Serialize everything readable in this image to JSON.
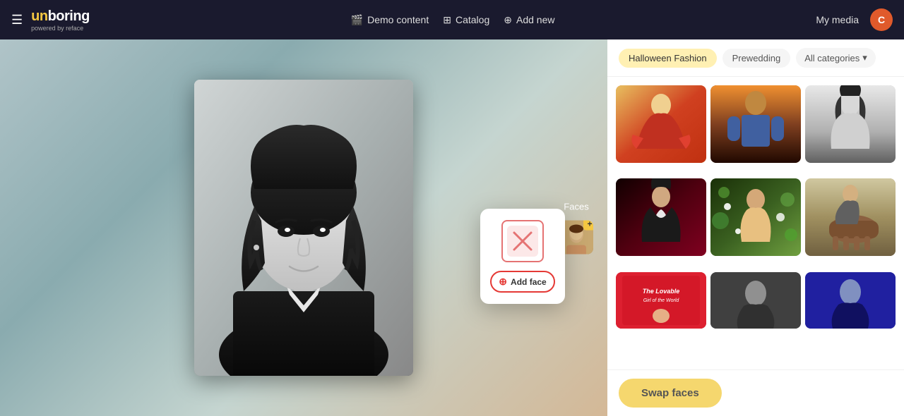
{
  "header": {
    "menu_icon": "☰",
    "logo_main": "unboring",
    "logo_highlight": "un",
    "logo_sub": "powered by reface",
    "nav": [
      {
        "id": "demo-content",
        "icon": "🎬",
        "label": "Demo content"
      },
      {
        "id": "catalog",
        "icon": "⊞",
        "label": "Catalog"
      },
      {
        "id": "add-new",
        "icon": "⊕",
        "label": "Add new"
      }
    ],
    "my_media": "My media",
    "avatar_letter": "C"
  },
  "categories": [
    {
      "id": "halloween",
      "label": "Halloween Fashion",
      "active": true
    },
    {
      "id": "prewedding",
      "label": "Prewedding",
      "active": false
    },
    {
      "id": "all",
      "label": "All categories",
      "active": false
    }
  ],
  "faces": {
    "label": "Faces"
  },
  "popup": {
    "add_face_label": "Add face"
  },
  "grid": {
    "images": [
      {
        "id": 1,
        "alt": "Indian dancer in red sari"
      },
      {
        "id": 2,
        "alt": "Muscular man in fantasy costume"
      },
      {
        "id": 3,
        "alt": "Woman in vintage black and white"
      },
      {
        "id": 4,
        "alt": "Woman in dark superhero outfit"
      },
      {
        "id": 5,
        "alt": "Woman among green flowers"
      },
      {
        "id": 6,
        "alt": "Woman on horse in countryside"
      },
      {
        "id": 7,
        "alt": "Vintage lovable magazine cover"
      },
      {
        "id": 8,
        "alt": "Dark portrait thumbnail"
      },
      {
        "id": 9,
        "alt": "Dark blue portrait thumbnail"
      }
    ]
  },
  "swap_button": {
    "label": "Swap faces"
  }
}
